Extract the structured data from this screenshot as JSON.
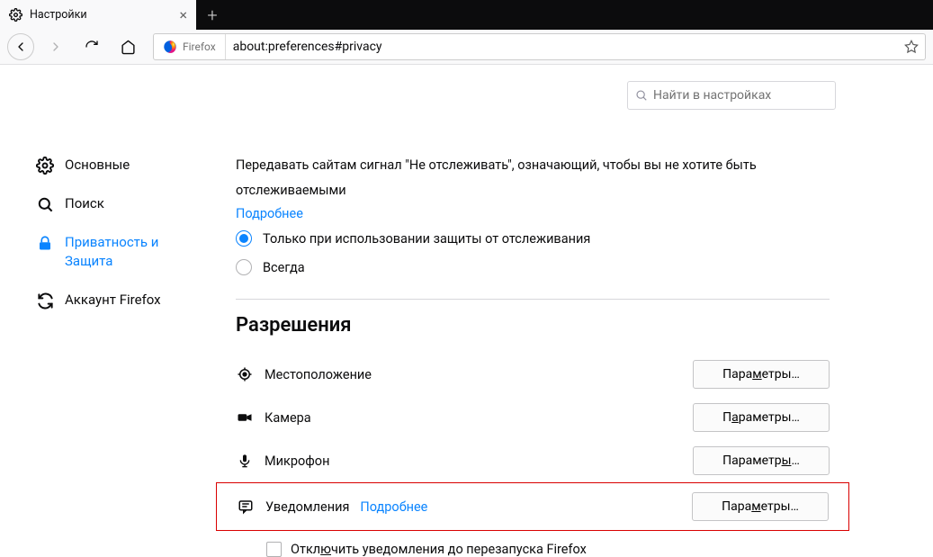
{
  "tab": {
    "title": "Настройки"
  },
  "urlbar": {
    "identity_label": "Firefox",
    "url": "about:preferences#privacy"
  },
  "sidebar": {
    "items": [
      {
        "label": "Основные"
      },
      {
        "label": "Поиск"
      },
      {
        "label": "Приватность и Защита"
      },
      {
        "label": "Аккаунт Firefox"
      }
    ]
  },
  "search": {
    "placeholder": "Найти в настройках"
  },
  "dnt": {
    "text": "Передавать сайтам сигнал \"Не отслеживать\", означающий, чтобы вы не хотите быть отслеживаемыми",
    "learn_more": "Подробнее",
    "options": [
      "Только при использовании защиты от отслеживания",
      "Всегда"
    ]
  },
  "permissions": {
    "heading": "Разрешения",
    "rows": [
      {
        "label": "Местоположение",
        "btn_pre": "Пара",
        "btn_u": "м",
        "btn_post": "етры…"
      },
      {
        "label": "Камера",
        "btn_pre": "П",
        "btn_u": "а",
        "btn_post": "раметры…"
      },
      {
        "label": "Микрофон",
        "btn_pre": "Параметр",
        "btn_u": "ы",
        "btn_post": "…"
      },
      {
        "label": "Уведомления",
        "btn_pre": "Пара",
        "btn_u": "м",
        "btn_post": "етры…",
        "learn_more": "Подробнее"
      }
    ],
    "pause_pre": "Откл",
    "pause_u": "ю",
    "pause_post": "чить уведомления до перезапуска Firefox"
  }
}
